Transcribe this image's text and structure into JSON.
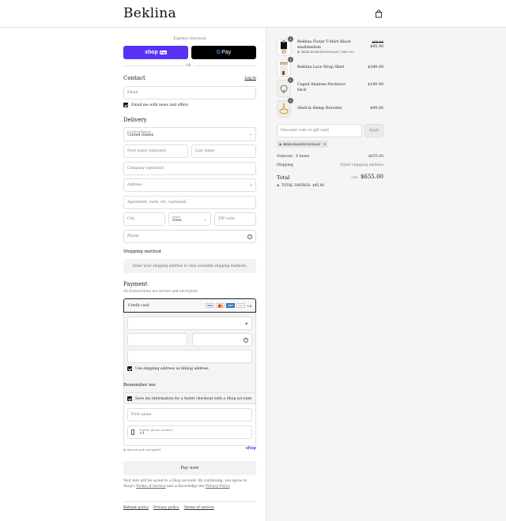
{
  "header": {
    "logo": "Beklina"
  },
  "express": {
    "label": "Express checkout",
    "shop_pay": "shop",
    "shop_pay_badge": "Pay",
    "gpay_g": "G",
    "gpay": "Pay",
    "or": "OR"
  },
  "contact": {
    "title": "Contact",
    "login": "Log in",
    "email_placeholder": "Email",
    "news_label": "Email me with news and offers"
  },
  "delivery": {
    "title": "Delivery",
    "country_label": "Country/Region",
    "country_value": "United States",
    "first_name": "First name (optional)",
    "last_name": "Last name",
    "company": "Company (optional)",
    "address": "Address",
    "apartment": "Apartment, suite, etc. (optional)",
    "city": "City",
    "state_label": "State",
    "state_value": "Iowa",
    "zip": "ZIP code",
    "phone": "Phone"
  },
  "shipping": {
    "title": "Shipping method",
    "message": "Enter your shipping address to view available shipping methods."
  },
  "payment": {
    "title": "Payment",
    "subtitle": "All transactions are secure and encrypted.",
    "method": "Credit card",
    "cards": [
      "VISA",
      "MC",
      "AMEX",
      "DISC"
    ],
    "more": "+4",
    "billing_label": "Use shipping address as billing address"
  },
  "remember": {
    "title": "Remember me",
    "save_label": "Save my information for a faster checkout with a Shop account",
    "first_name": "First name",
    "mobile_label": "Mobile phone number",
    "mobile_value": "+1"
  },
  "secure": {
    "label": "Secure and encrypted",
    "brand": "shop"
  },
  "pay_button": "Pay now",
  "legal": {
    "line1": "Your info will be saved to a Shop account. By continuing, you agree to",
    "line2_a": "Shop's ",
    "terms": "Terms of Service",
    "line2_b": " and acknowledge the ",
    "privacy": "Privacy Policy",
    "line2_c": "."
  },
  "footer": {
    "refund": "Refund policy",
    "privacy": "Privacy policy",
    "terms": "Terms of service"
  },
  "cart": {
    "items": [
      {
        "qty": "1",
        "name": "Beklina Flotar T-Shirt Black",
        "variant": "small/medium",
        "discount": "BEKLINAWHOLESALE (-$45.00)",
        "old_price": "$90.00",
        "price": "$45.00"
      },
      {
        "qty": "1",
        "name": "Beklina Lace Wrap Skirt",
        "price": "$340.00"
      },
      {
        "qty": "1",
        "name": "Caged Abalone Necklace",
        "variant": "black",
        "price": "$180.00"
      },
      {
        "qty": "1",
        "name": "Shell & Hemp Bracelet",
        "price": "$90.00"
      }
    ],
    "discount_placeholder": "Discount code or gift card",
    "apply": "Apply",
    "applied_code": "BEKLINAWHOLESALE",
    "subtotal_label": "Subtotal · 4 items",
    "subtotal_value": "$655.00",
    "shipping_label": "Shipping",
    "shipping_value": "Enter shipping address",
    "total_label": "Total",
    "currency": "USD",
    "total_value": "$655.00",
    "savings_label": "TOTAL SAVINGS",
    "savings_value": "$45.00"
  },
  "colors": {
    "shop_pay": "#5a31f4",
    "accent": "#1a1a1a",
    "panel": "#f5f5f5"
  }
}
